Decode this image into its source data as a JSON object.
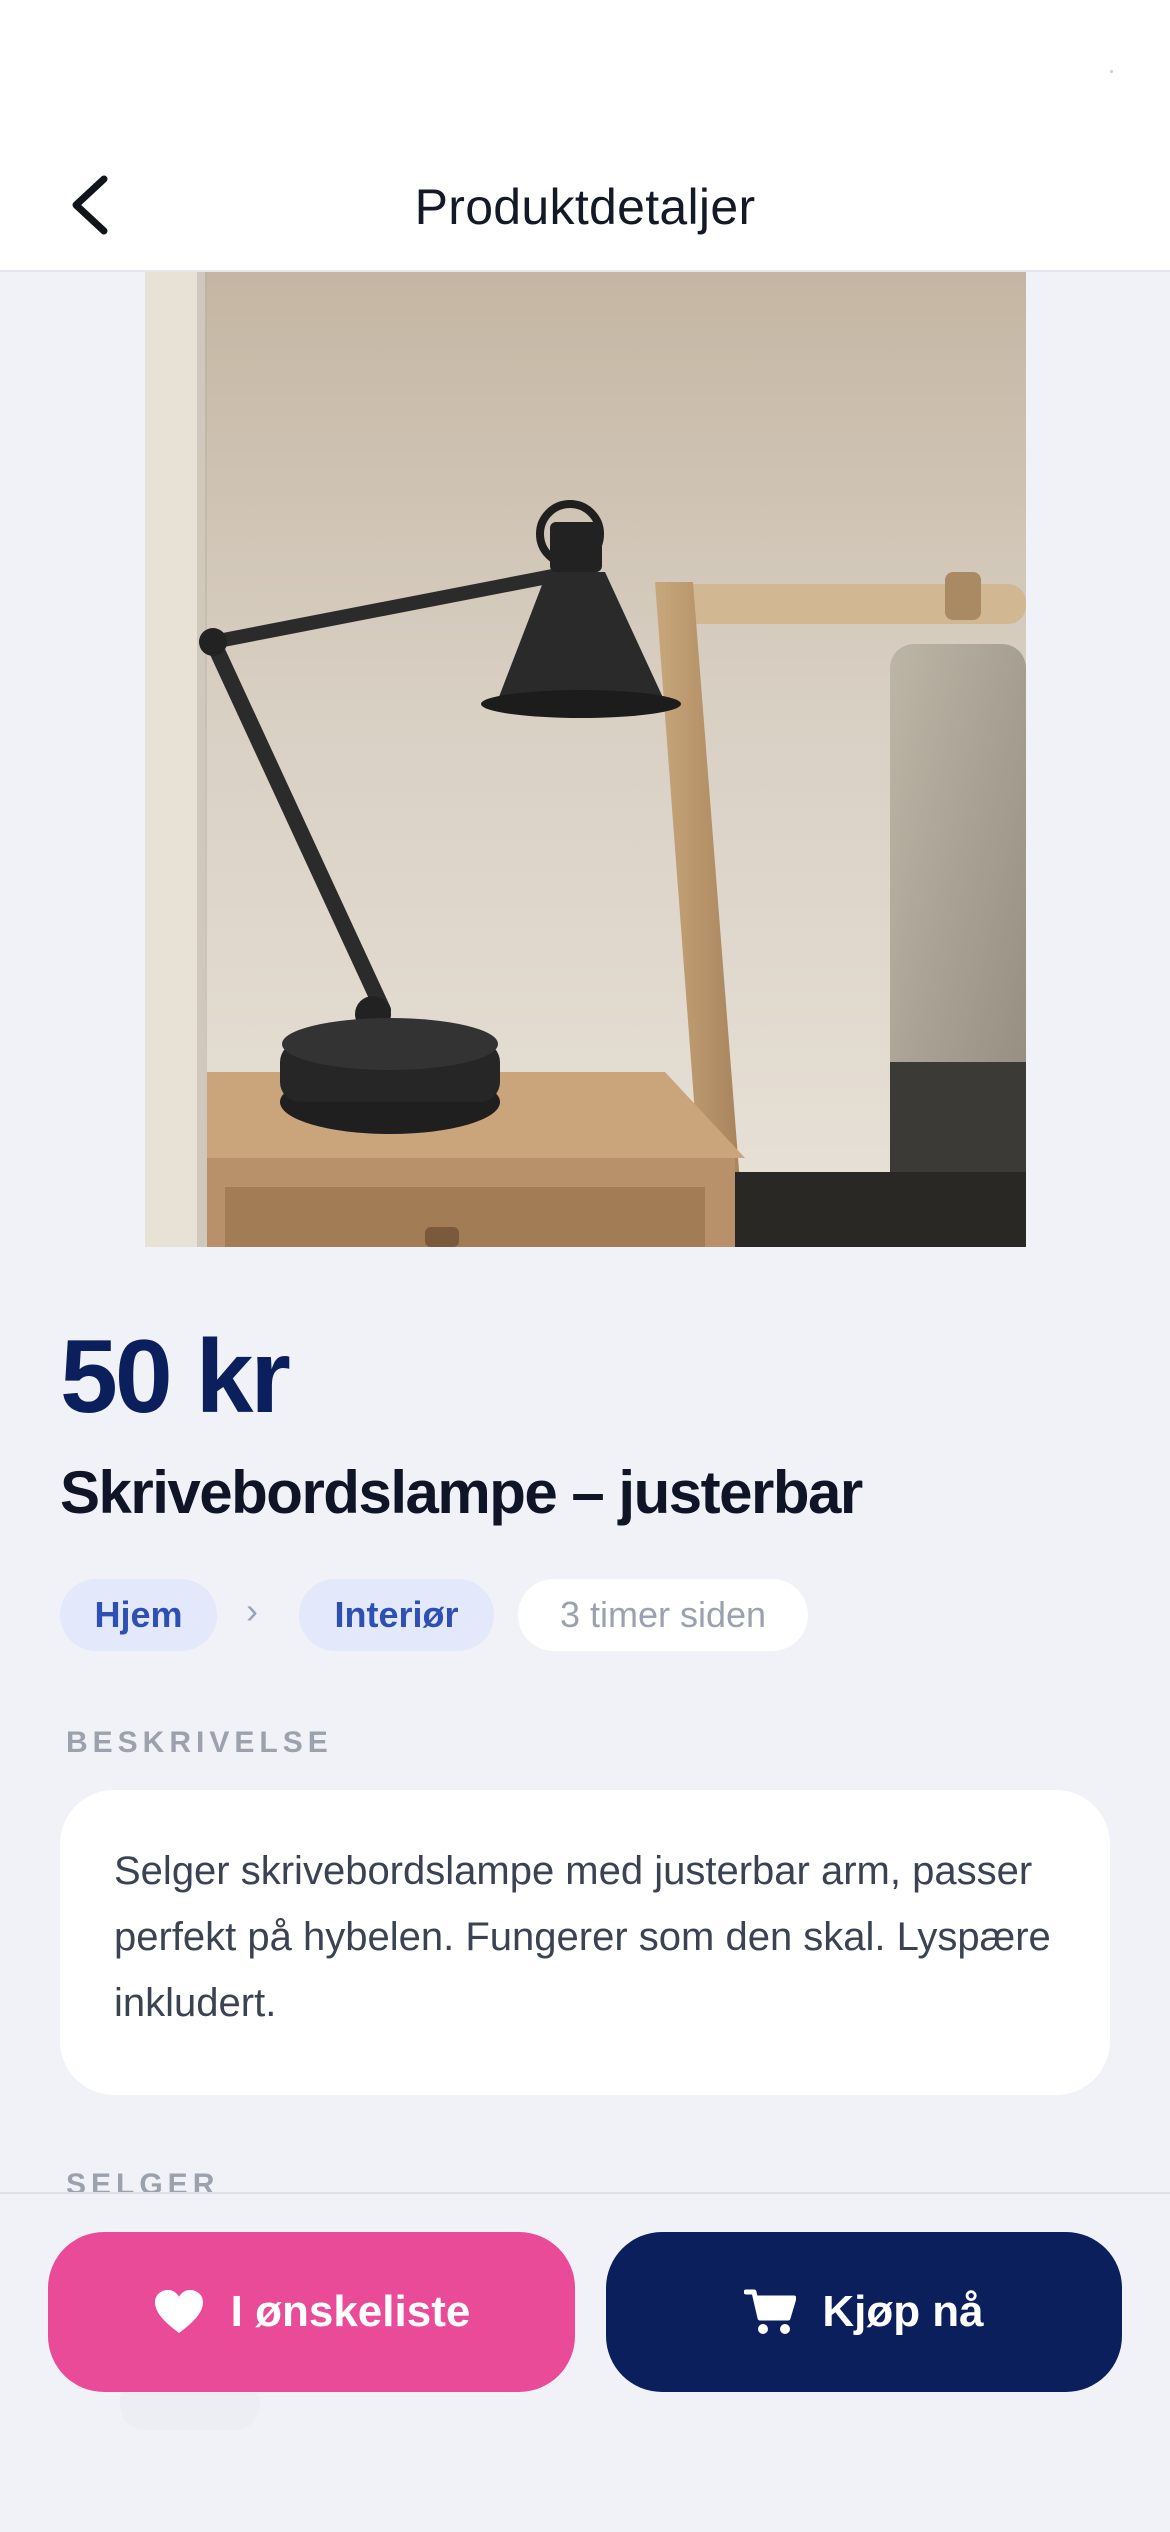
{
  "header": {
    "title": "Produktdetaljer",
    "back_icon": "chevron-left-icon"
  },
  "product": {
    "image_alt": "Svart skrivebordslampe på nattbord",
    "price": "50 kr",
    "title": "Skrivebordslampe – justerbar",
    "breadcrumb": {
      "category": "Hjem",
      "separator": "›",
      "subcategory": "Interiør"
    },
    "posted": "3 timer siden"
  },
  "description": {
    "label": "BESKRIVELSE",
    "text": "Selger skrivebordslampe med justerbar arm, passer perfekt på hybelen. Fungerer som den skal. Lyspære inkludert."
  },
  "seller": {
    "label": "SELGER"
  },
  "actions": {
    "wishlist_label": "I ønskeliste",
    "wishlist_icon": "heart-icon",
    "buy_label": "Kjøp nå",
    "buy_icon": "cart-icon"
  },
  "colors": {
    "primary": "#0b1f5c",
    "accent_pink": "#e94b98",
    "background": "#f1f2f7"
  }
}
